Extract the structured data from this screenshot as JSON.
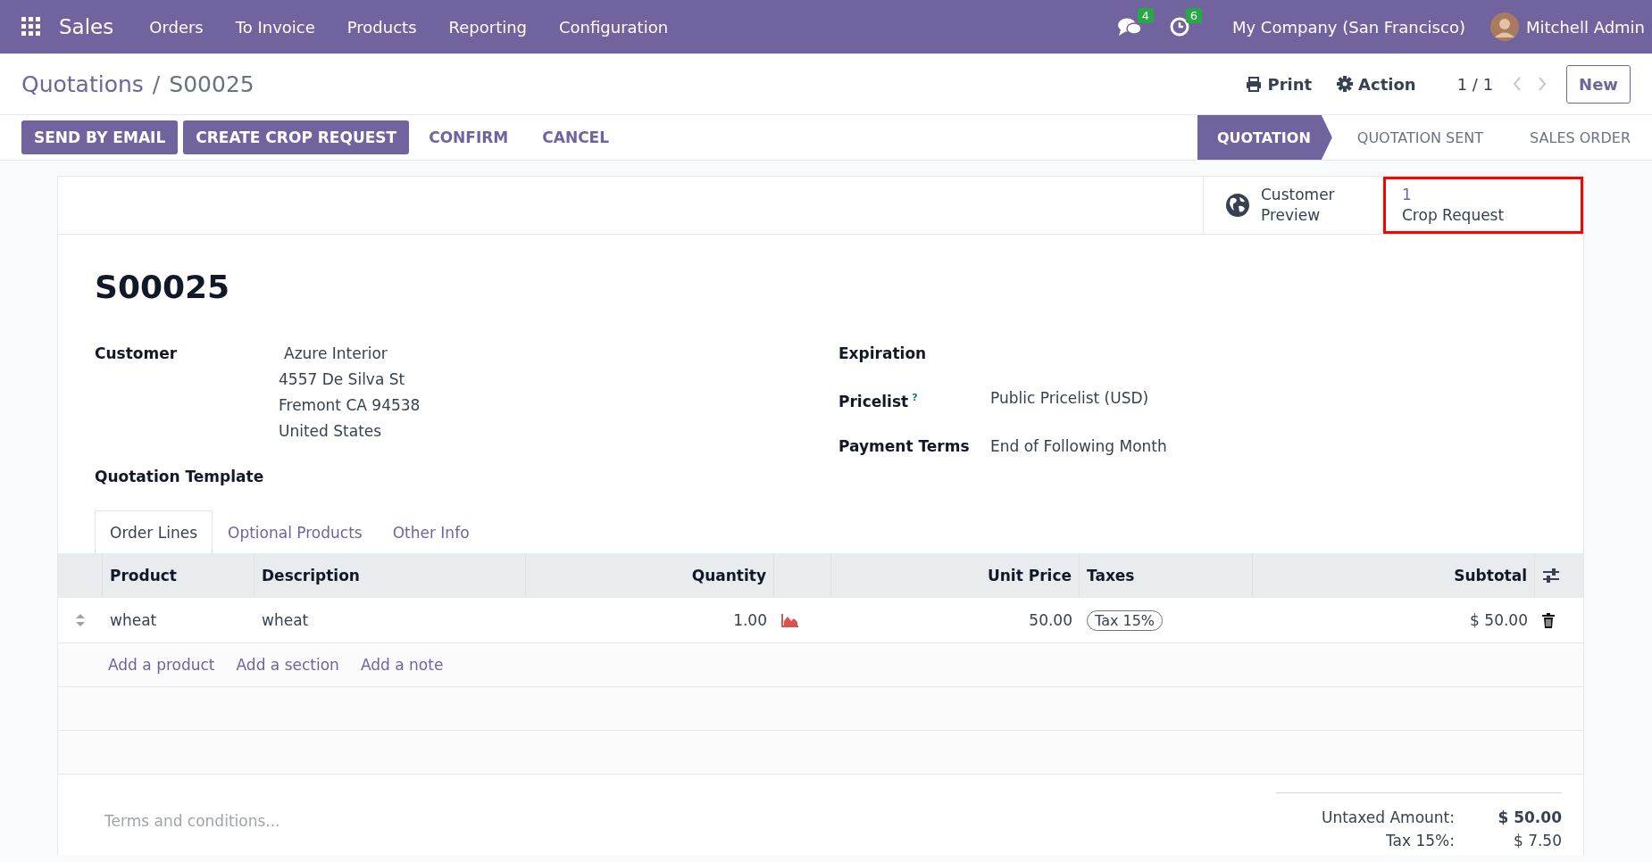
{
  "navbar": {
    "app": "Sales",
    "menu": [
      "Orders",
      "To Invoice",
      "Products",
      "Reporting",
      "Configuration"
    ],
    "messages_count": "4",
    "activities_count": "6",
    "company": "My Company (San Francisco)",
    "user": "Mitchell Admin"
  },
  "breadcrumb": {
    "parent": "Quotations",
    "separator": "/",
    "current": "S00025"
  },
  "control": {
    "print": "Print",
    "action": "Action",
    "pager": "1 / 1",
    "new": "New"
  },
  "buttons": [
    {
      "label": "SEND BY EMAIL",
      "kind": "primary"
    },
    {
      "label": "CREATE CROP REQUEST",
      "kind": "primary"
    },
    {
      "label": "CONFIRM",
      "kind": "link"
    },
    {
      "label": "CANCEL",
      "kind": "link"
    }
  ],
  "status": [
    {
      "label": "QUOTATION",
      "selected": true
    },
    {
      "label": "QUOTATION SENT",
      "selected": false
    },
    {
      "label": "SALES ORDER",
      "selected": false
    }
  ],
  "smart_buttons": [
    {
      "kind": "preview",
      "label": "Customer",
      "label2": "Preview",
      "highlighted": false
    },
    {
      "kind": "count",
      "count": "1",
      "label": "Crop Request",
      "highlighted": true
    }
  ],
  "title": "S00025",
  "fields_left": [
    {
      "label": "Customer",
      "lines": [
        "Azure Interior",
        "4557 De Silva St",
        "Fremont CA 94538",
        "United States"
      ]
    },
    {
      "label": "Quotation Template"
    }
  ],
  "fields_right": [
    {
      "label": "Expiration"
    },
    {
      "label": "Pricelist",
      "help": "?",
      "value": "Public Pricelist (USD)"
    },
    {
      "label": "Payment Terms",
      "value": "End of Following Month"
    }
  ],
  "tabs": [
    {
      "label": "Order Lines",
      "selected": true
    },
    {
      "label": "Optional Products",
      "selected": false
    },
    {
      "label": "Other Info",
      "selected": false
    }
  ],
  "table": {
    "columns": [
      "Product",
      "Description",
      "Quantity",
      "Unit Price",
      "Taxes",
      "Subtotal"
    ],
    "rows": [
      {
        "product": "wheat",
        "description": "wheat",
        "quantity": "1.00",
        "unit_price": "50.00",
        "taxes": [
          "Tax 15%"
        ],
        "subtotal": "$ 50.00"
      }
    ],
    "add_links": [
      "Add a product",
      "Add a section",
      "Add a note"
    ]
  },
  "terms_placeholder": "Terms and conditions...",
  "totals": [
    {
      "label": "Untaxed Amount:",
      "value": "$ 50.00",
      "bold": true
    },
    {
      "label": "Tax 15%:",
      "value": "$ 7.50",
      "bold": false
    }
  ]
}
